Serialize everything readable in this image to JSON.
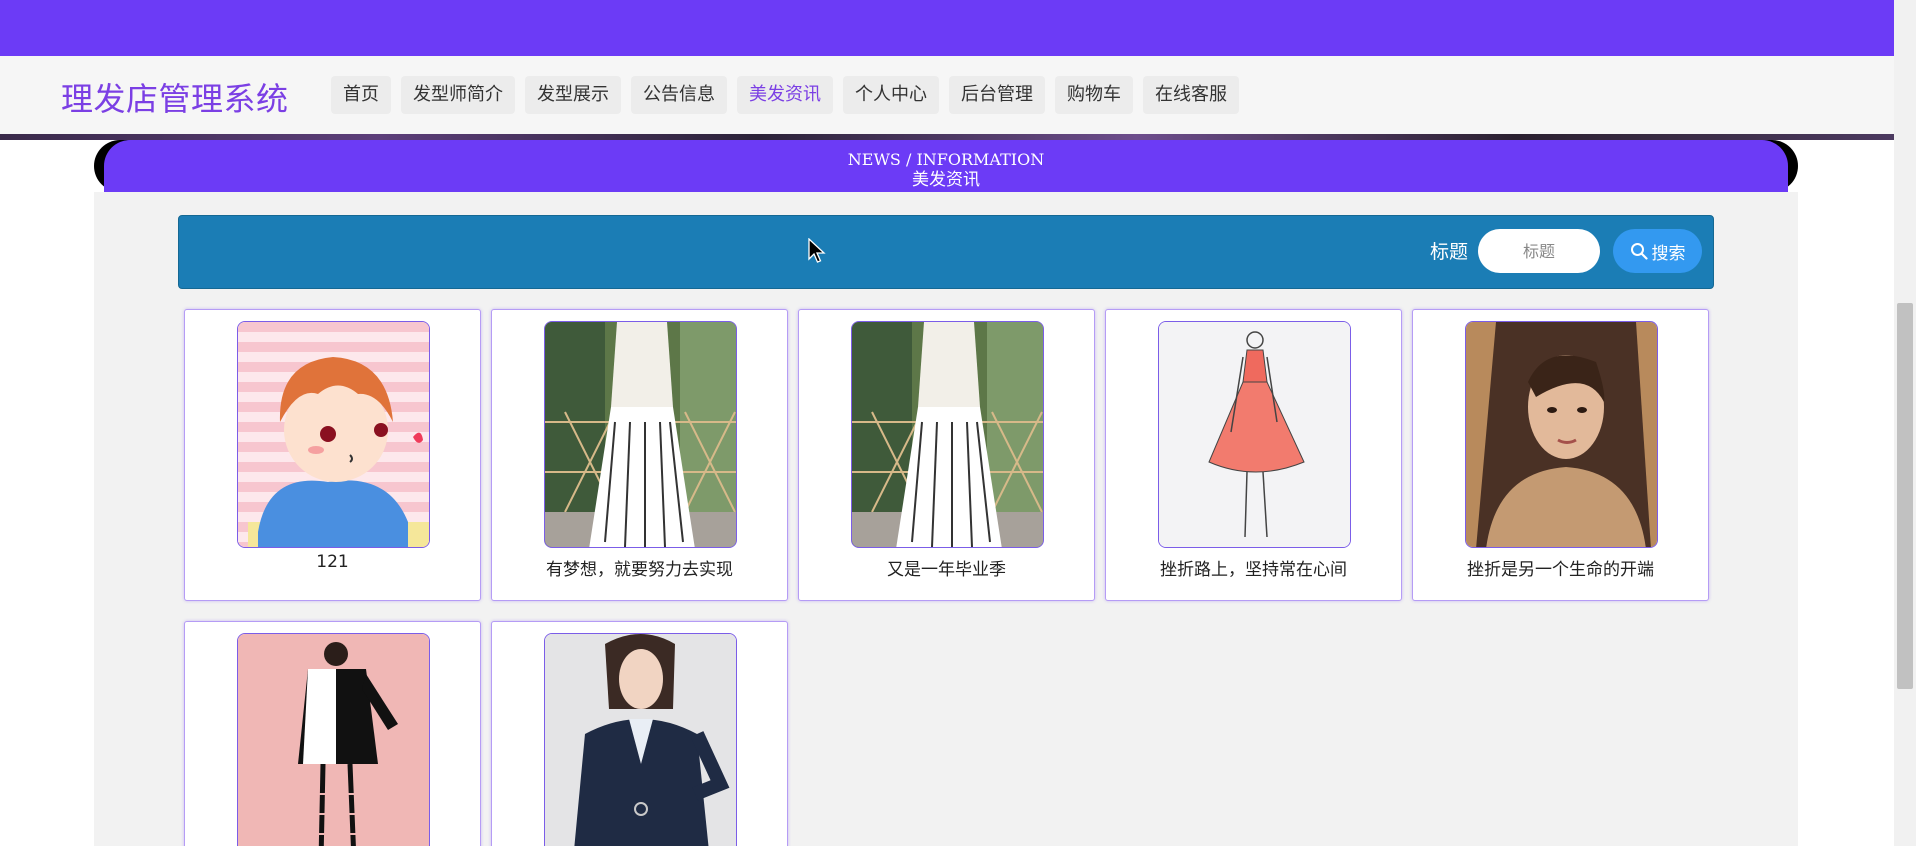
{
  "brand": "理发店管理系统",
  "nav": {
    "items": [
      {
        "label": "首页",
        "active": false
      },
      {
        "label": "发型师简介",
        "active": false
      },
      {
        "label": "发型展示",
        "active": false
      },
      {
        "label": "公告信息",
        "active": false
      },
      {
        "label": "美发资讯",
        "active": true
      },
      {
        "label": "个人中心",
        "active": false
      },
      {
        "label": "后台管理",
        "active": false
      },
      {
        "label": "购物车",
        "active": false
      },
      {
        "label": "在线客服",
        "active": false
      }
    ]
  },
  "section": {
    "title_en": "NEWS / INFORMATION",
    "title_cn": "美发资讯"
  },
  "search": {
    "label": "标题",
    "placeholder": "标题",
    "button_label": "搜索"
  },
  "news": [
    {
      "caption": "121",
      "thumb": "cartoon-boy"
    },
    {
      "caption": "有梦想，就要努力去实现",
      "thumb": "woman-striped-skirt"
    },
    {
      "caption": "又是一年毕业季",
      "thumb": "woman-striped-skirt"
    },
    {
      "caption": "挫折路上，坚持常在心间",
      "thumb": "red-dress-sketch"
    },
    {
      "caption": "挫折是另一个生命的开端",
      "thumb": "woman-portrait"
    },
    {
      "caption": "",
      "thumb": "woman-black-white-dress"
    },
    {
      "caption": "",
      "thumb": "woman-navy-suit"
    }
  ],
  "colors": {
    "accent": "#6c3bf6",
    "brand_text": "#7b3fe4",
    "search_bar": "#1b7db5",
    "search_button": "#3399f0"
  }
}
